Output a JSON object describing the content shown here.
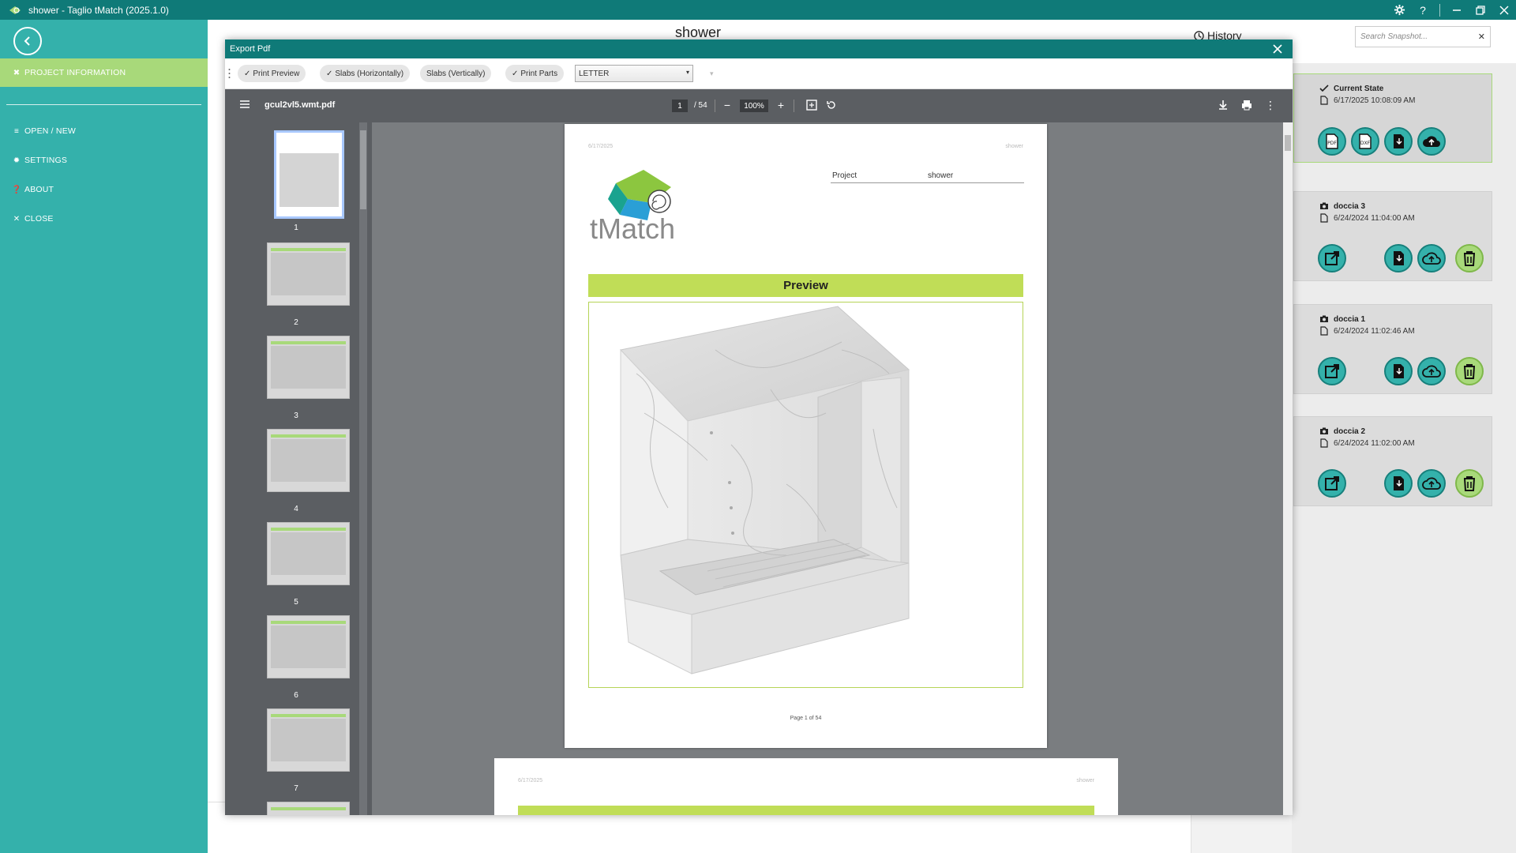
{
  "window": {
    "title": "shower - Taglio tMatch (2025.1.0)"
  },
  "sidebar": {
    "items": [
      {
        "label": "PROJECT INFORMATION",
        "icon": "tools-icon"
      },
      {
        "label": "OPEN / NEW",
        "icon": "list-icon"
      },
      {
        "label": "SETTINGS",
        "icon": "gear-icon"
      },
      {
        "label": "ABOUT",
        "icon": "question-icon"
      },
      {
        "label": "CLOSE",
        "icon": "close-icon"
      }
    ]
  },
  "main": {
    "project_title": "shower",
    "history_label": "History"
  },
  "search": {
    "placeholder": "Search Snapshot..."
  },
  "snapshots": [
    {
      "name": "Current State",
      "date": "6/17/2025 10:08:09 AM"
    },
    {
      "name": "doccia 3",
      "date": "6/24/2024 11:04:00 AM"
    },
    {
      "name": "doccia 1",
      "date": "6/24/2024 11:02:46 AM"
    },
    {
      "name": "doccia 2",
      "date": "6/24/2024 11:02:00 AM"
    }
  ],
  "dialog": {
    "title": "Export Pdf",
    "chips": [
      {
        "label": "Print Preview",
        "checked": true
      },
      {
        "label": "Slabs (Horizontally)",
        "checked": true
      },
      {
        "label": "Slabs (Vertically)",
        "checked": false
      },
      {
        "label": "Print Parts",
        "checked": true
      }
    ],
    "paper_size": "LETTER"
  },
  "pdf": {
    "filename": "gcul2vl5.wmt.pdf",
    "current_page": "1",
    "total_pages": "/ 54",
    "zoom": "100%",
    "thumbnails": [
      "1",
      "2",
      "3",
      "4",
      "5",
      "6",
      "7"
    ],
    "page": {
      "date": "6/17/2025",
      "header_project": "shower",
      "project_label": "Project",
      "project_value": "shower",
      "logo_text": "tMatch",
      "section_title": "Preview",
      "footer": "Page 1 of 54"
    },
    "page2": {
      "date": "6/17/2025",
      "header_project": "shower"
    }
  },
  "colors": {
    "teal": "#34b1ab",
    "dark_teal": "#0f7a78",
    "lime": "#a8d97a",
    "preview_bar": "#c0dd57"
  }
}
